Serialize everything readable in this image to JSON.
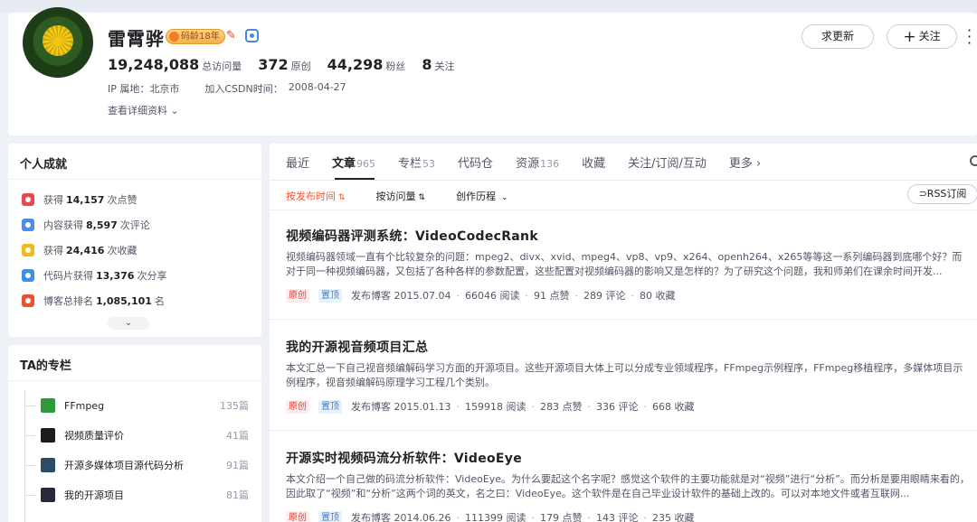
{
  "profile": {
    "name": "雷霄骅",
    "badge_age": "码龄18年",
    "stats": [
      {
        "value": "19,248,088",
        "label": "总访问量"
      },
      {
        "value": "372",
        "label": "原创"
      },
      {
        "value": "44,298",
        "label": "粉丝"
      },
      {
        "value": "8",
        "label": "关注"
      }
    ],
    "ip": "IP 属地：北京市",
    "join_label": "加入CSDN时间：",
    "join_date": "2008-04-27",
    "detail_link": "查看详细资料",
    "buttons": {
      "update": "求更新",
      "follow": "关注"
    }
  },
  "achievements": {
    "title": "个人成就",
    "items": [
      {
        "prefix": "获得",
        "value": "14,157",
        "suffix": "次点赞",
        "color": "#e5484d"
      },
      {
        "prefix": "内容获得",
        "value": "8,597",
        "suffix": "次评论",
        "color": "#4c8dea"
      },
      {
        "prefix": "获得",
        "value": "24,416",
        "suffix": "次收藏",
        "color": "#f2b91c"
      },
      {
        "prefix": "代码片获得",
        "value": "13,376",
        "suffix": "次分享",
        "color": "#3e8fe8"
      },
      {
        "prefix": "博客总排名",
        "value": "1,085,101",
        "suffix": "名",
        "color": "#e8522d"
      }
    ]
  },
  "columns": {
    "title": "TA的专栏",
    "items": [
      {
        "name": "FFmpeg",
        "count": "135篇",
        "color": "#2f9a3c"
      },
      {
        "name": "视频质量评价",
        "count": "41篇",
        "color": "#1c1c1c"
      },
      {
        "name": "开源多媒体项目源代码分析",
        "count": "91篇",
        "color": "#2a4e6a"
      },
      {
        "name": "我的开源项目",
        "count": "81篇",
        "color": "#242a3a"
      }
    ]
  },
  "tabs": [
    {
      "label": "最近",
      "count": ""
    },
    {
      "label": "文章",
      "count": "965"
    },
    {
      "label": "专栏",
      "count": "53"
    },
    {
      "label": "代码仓",
      "count": ""
    },
    {
      "label": "资源",
      "count": "136"
    },
    {
      "label": "收藏",
      "count": ""
    },
    {
      "label": "关注/订阅/互动",
      "count": ""
    },
    {
      "label": "更多",
      "count": ""
    }
  ],
  "sort": {
    "by_time": "按发布时间",
    "by_views": "按访问量",
    "history": "创作历程",
    "rss": "RSS订阅"
  },
  "articles": [
    {
      "title": "视频编码器评测系统：VideoCodecRank",
      "desc": "视频编码器领域一直有个比较复杂的问题：mpeg2、divx、xvid、mpeg4、vp8、vp9、x264、openh264、x265等等这一系列编码器到底哪个好？而对于同一种视频编码器，又包括了各种各样的参数配置，这些配置对视频编码器的影响又是怎样的？为了研究这个问题，我和师弟们在课余时间开发...",
      "tag_orig": "原创",
      "tag_top": "置顶",
      "date": "发布博客 2015.07.04",
      "views": "66046 阅读",
      "likes": "91 点赞",
      "comments": "289 评论",
      "favs": "80 收藏"
    },
    {
      "title": "我的开源视音频项目汇总",
      "desc": "本文汇总一下自己视音频编解码学习方面的开源项目。这些开源项目大体上可以分成专业领域程序，FFmpeg示例程序，FFmpeg移植程序，多媒体项目示例程序，视音频编解码原理学习工程几个类别。",
      "tag_orig": "原创",
      "tag_top": "置顶",
      "date": "发布博客 2015.01.13",
      "views": "159918 阅读",
      "likes": "283 点赞",
      "comments": "336 评论",
      "favs": "668 收藏"
    },
    {
      "title": "开源实时视频码流分析软件：VideoEye",
      "desc": "本文介绍一个自己做的码流分析软件：VideoEye。为什么要起这个名字呢？感觉这个软件的主要功能就是对“视频”进行“分析”。而分析是要用眼睛来看的，因此取了“视频”和“分析”这两个词的英文，名之曰：VideoEye。这个软件是在自己毕业设计软件的基础上改的。可以对本地文件或者互联网...",
      "tag_orig": "原创",
      "tag_top": "置顶",
      "date": "发布博客 2014.06.26",
      "views": "111399 阅读",
      "likes": "179 点赞",
      "comments": "143 评论",
      "favs": "235 收藏"
    }
  ]
}
